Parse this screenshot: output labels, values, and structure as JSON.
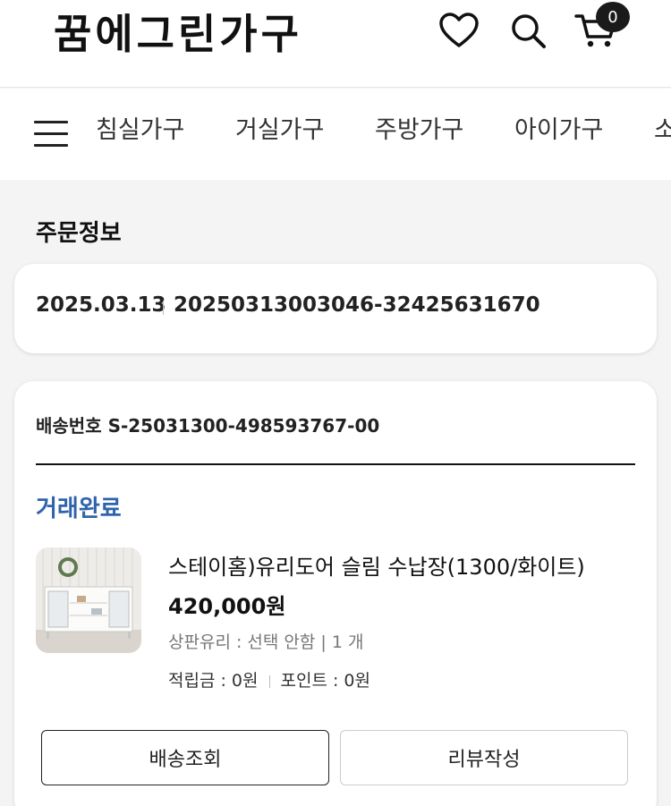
{
  "header": {
    "logo": "꿈에그린가구",
    "icons": [
      "heart-icon",
      "search-icon",
      "cart-icon"
    ],
    "cart_count": "0"
  },
  "nav": {
    "items": [
      "침실가구",
      "거실가구",
      "주방가구",
      "아이가구",
      "소"
    ]
  },
  "order_info": {
    "title": "주문정보",
    "date": "2025.03.13",
    "order_number": "20250313003046-32425631670"
  },
  "shipment": {
    "shipping_number": "배송번호 S-25031300-498593767-00",
    "status": "거래완료",
    "status_color": "#2f64ad",
    "product": {
      "name": "스테이홈)유리도어 슬림 수납장(1300/화이트)",
      "price": "420,000원",
      "options": "상판유리 : 선택 안함 | 1 개",
      "reward": "적립금 : 0원",
      "points": "포인트 : 0원"
    },
    "buttons": {
      "track": "배송조회",
      "review": "리뷰작성"
    }
  }
}
